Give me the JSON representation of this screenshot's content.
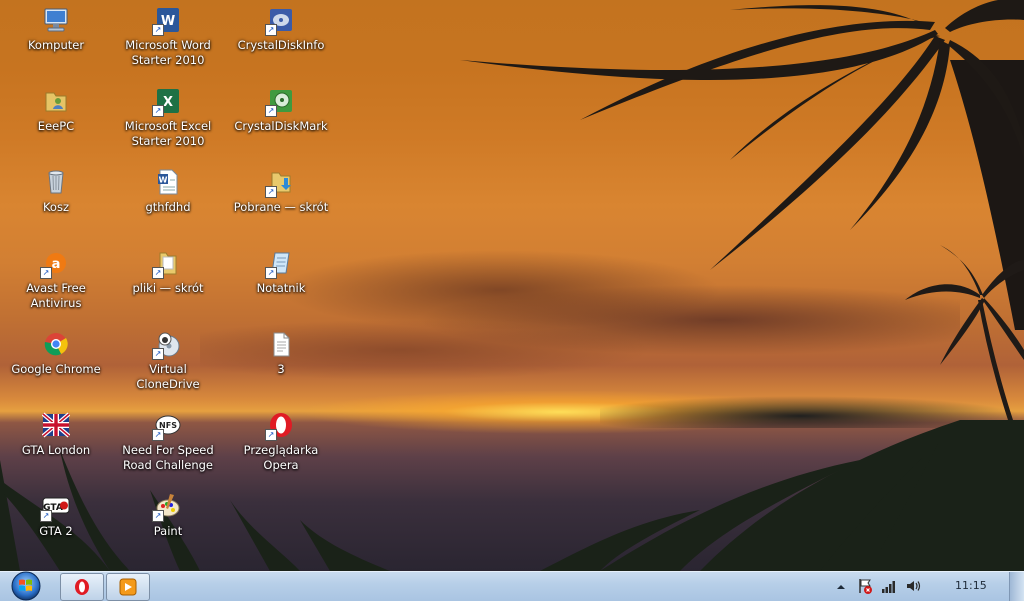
{
  "desktop": {
    "icons": [
      {
        "label": "Komputer",
        "icon": "computer-icon"
      },
      {
        "label": "EeePC",
        "icon": "user-folder-icon"
      },
      {
        "label": "Kosz",
        "icon": "recycle-bin-icon"
      },
      {
        "label": "Avast Free Antivirus",
        "icon": "avast-icon"
      },
      {
        "label": "Google Chrome",
        "icon": "chrome-icon"
      },
      {
        "label": "GTA London",
        "icon": "union-jack-icon"
      },
      {
        "label": "GTA 2",
        "icon": "gta2-icon"
      },
      {
        "label": "Microsoft Word\nStarter 2010",
        "icon": "word-icon"
      },
      {
        "label": "Microsoft Excel\nStarter 2010",
        "icon": "excel-icon"
      },
      {
        "label": "gthfdhd",
        "icon": "word-document-icon"
      },
      {
        "label": "pliki — skrót",
        "icon": "folder-shortcut-icon"
      },
      {
        "label": "Virtual CloneDrive",
        "icon": "sheep-disc-icon"
      },
      {
        "label": "Need For Speed\nRoad Challenge",
        "icon": "nfs-icon"
      },
      {
        "label": "Paint",
        "icon": "paint-icon"
      },
      {
        "label": "CrystalDiskInfo",
        "icon": "crystaldiskinfo-icon"
      },
      {
        "label": "CrystalDiskMark",
        "icon": "crystaldiskmark-icon"
      },
      {
        "label": "Pobrane — skrót",
        "icon": "downloads-folder-icon"
      },
      {
        "label": "Notatnik",
        "icon": "notepad-icon"
      },
      {
        "label": "3",
        "icon": "text-file-icon"
      },
      {
        "label": "Przeglądarka Opera",
        "icon": "opera-icon"
      }
    ]
  },
  "taskbar": {
    "pinned": [
      {
        "name": "opera",
        "icon": "opera-icon"
      },
      {
        "name": "media-player",
        "icon": "media-player-icon"
      }
    ],
    "tray": {
      "clock": "11:15"
    }
  },
  "colors": {
    "taskbar": "#b7cfe8",
    "label_text": "#ffffff"
  }
}
